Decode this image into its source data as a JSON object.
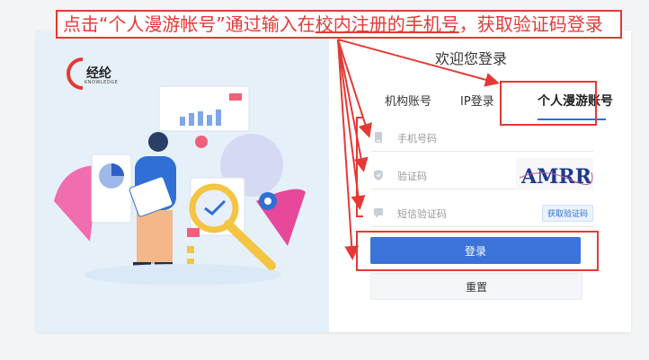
{
  "annotation": {
    "prefix": "点击“个人漫游帐号”通过输入在",
    "underlined": "校内注册的手机号",
    "suffix": "，获取验证码登录"
  },
  "logo": {
    "name": "经纶",
    "sub": "KNOWLEDGE"
  },
  "welcome": "欢迎您登录",
  "tabs": [
    {
      "label": "机构账号"
    },
    {
      "label": "IP登录"
    },
    {
      "label": "个人漫游账号",
      "active": true
    }
  ],
  "form": {
    "phone_placeholder": "手机号码",
    "captcha_placeholder": "验证码",
    "captcha_text": "AMRR",
    "sms_placeholder": "短信验证码",
    "sms_button": "获取验证码"
  },
  "buttons": {
    "login": "登录",
    "reset": "重置"
  },
  "colors": {
    "annotation_red": "#e53935",
    "primary_blue": "#3b73d9"
  }
}
